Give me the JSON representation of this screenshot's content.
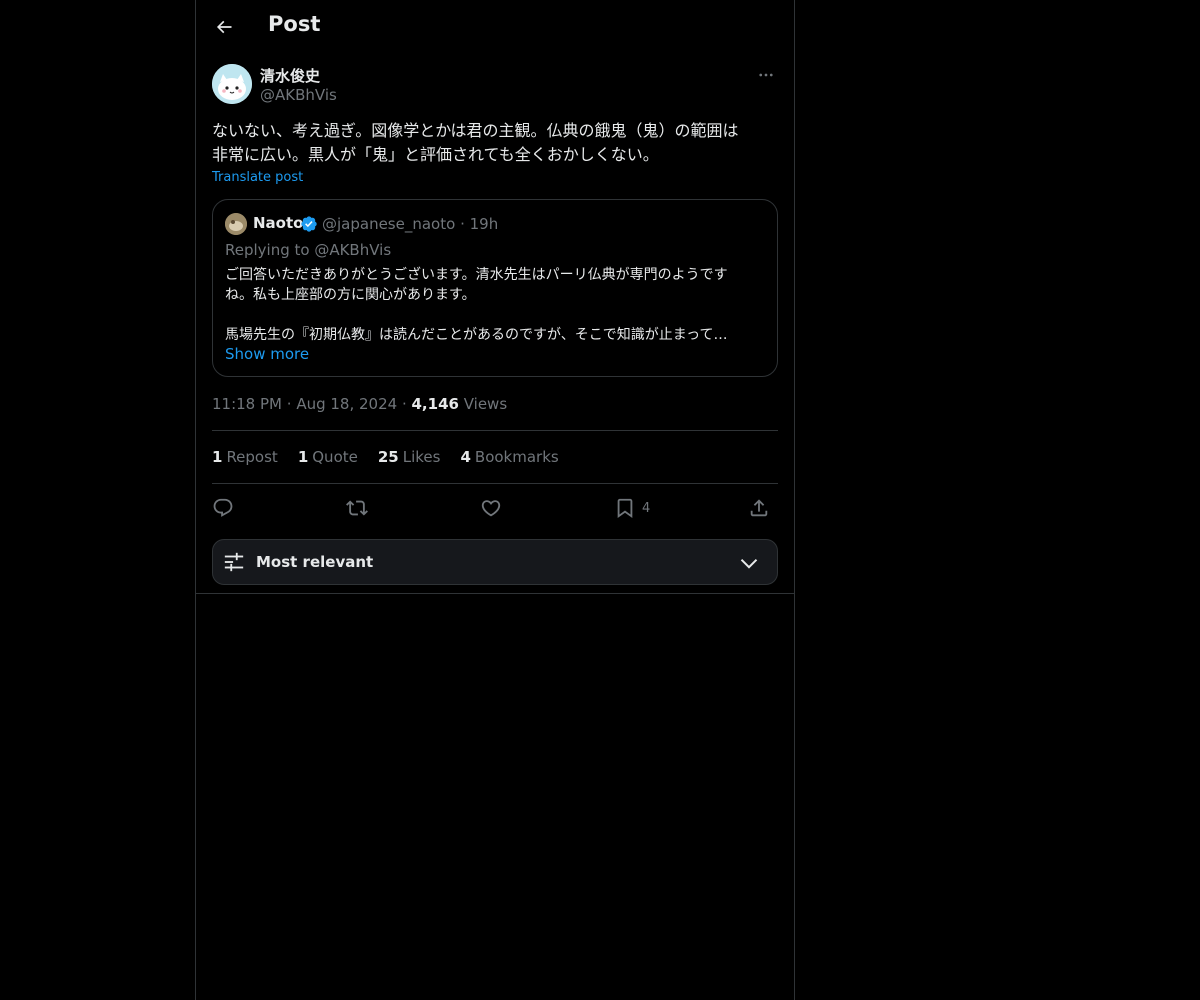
{
  "header": {
    "title": "Post",
    "back_icon": "arrow-left-icon"
  },
  "author": {
    "name": "清水俊史",
    "handle": "@AKBhVis",
    "more_icon": "more-horizontal-icon"
  },
  "post": {
    "text": "ないない、考え過ぎ。図像学とかは君の主観。仏典の餓鬼（鬼）の範囲は\n非常に広い。黒人が「鬼」と評価されても全くおかしくない。",
    "translate_label": "Translate post",
    "time": "11:18 PM",
    "date": "Aug 18, 2024",
    "views_count": "4,146",
    "views_label": "Views"
  },
  "quote": {
    "name": "Naoto",
    "verified_icon": "verified-badge-icon",
    "handle": "@japanese_naoto",
    "time": "19h",
    "replying_to": "Replying to @AKBhVis",
    "text": "ご回答いただきありがとうございます。清水先生はパーリ仏典が専門のようです\nね。私も上座部の方に関心があります。\n\n馬場先生の『初期仏教』は読んだことがあるのですが、そこで知識が止まって…",
    "show_more": "Show more"
  },
  "stats": [
    {
      "count": "1",
      "label": "Repost"
    },
    {
      "count": "1",
      "label": "Quote"
    },
    {
      "count": "25",
      "label": "Likes"
    },
    {
      "count": "4",
      "label": "Bookmarks"
    }
  ],
  "actions": {
    "reply_icon": "reply-icon",
    "repost_icon": "repost-icon",
    "like_icon": "heart-icon",
    "bookmark_icon": "bookmark-icon",
    "bookmark_count": "4",
    "share_icon": "share-icon"
  },
  "sort": {
    "label": "Most relevant",
    "icon": "sliders-icon",
    "chevron": "chevron-down-icon"
  },
  "colors": {
    "background": "#000000",
    "text": "#e7e9ea",
    "muted": "#71767b",
    "accent": "#1d9bf0",
    "border": "#2f3336"
  }
}
